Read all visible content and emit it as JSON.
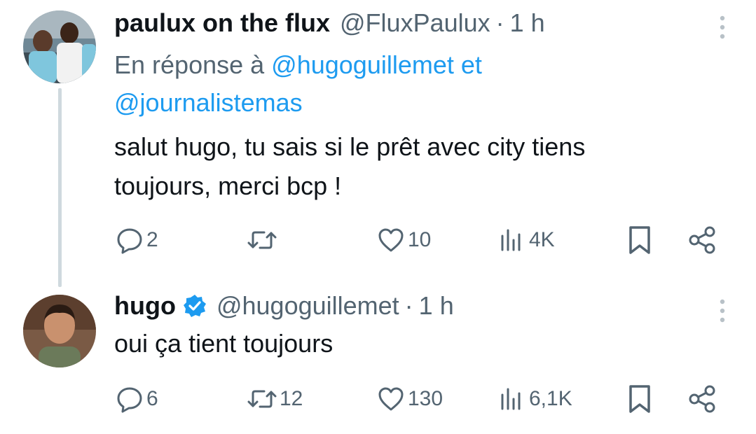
{
  "tweets": [
    {
      "display_name": "paulux on the flux",
      "handle": "@FluxPaulux",
      "separator": "·",
      "time": "1 h",
      "reply_prefix": "En réponse à",
      "reply_mention_1": "@hugoguillemet",
      "reply_joiner": "et",
      "reply_mention_2": "@journalistemas",
      "text_line_1": "salut hugo, tu sais si le prêt avec city tiens",
      "text_line_2": "toujours, merci bcp !",
      "replies": "2",
      "retweets": "",
      "likes": "10",
      "views": "4K",
      "verified": false
    },
    {
      "display_name": "hugo",
      "handle": "@hugoguillemet",
      "separator": "·",
      "time": "1 h",
      "text_line_1": "oui ça tient toujours",
      "replies": "6",
      "retweets": "12",
      "likes": "130",
      "views": "6,1K",
      "verified": true
    }
  ],
  "icons": {
    "reply": "speech-bubble-icon",
    "retweet": "retweet-arrows-icon",
    "like": "heart-icon",
    "views": "bar-chart-icon",
    "bookmark": "bookmark-icon",
    "share": "share-nodes-icon",
    "more": "vertical-ellipsis-icon",
    "verified": "verified-badge-icon"
  },
  "colors": {
    "text_primary": "#0f1419",
    "text_secondary": "#536471",
    "accent": "#1d9bf0",
    "thread_line": "#cfd9de"
  }
}
